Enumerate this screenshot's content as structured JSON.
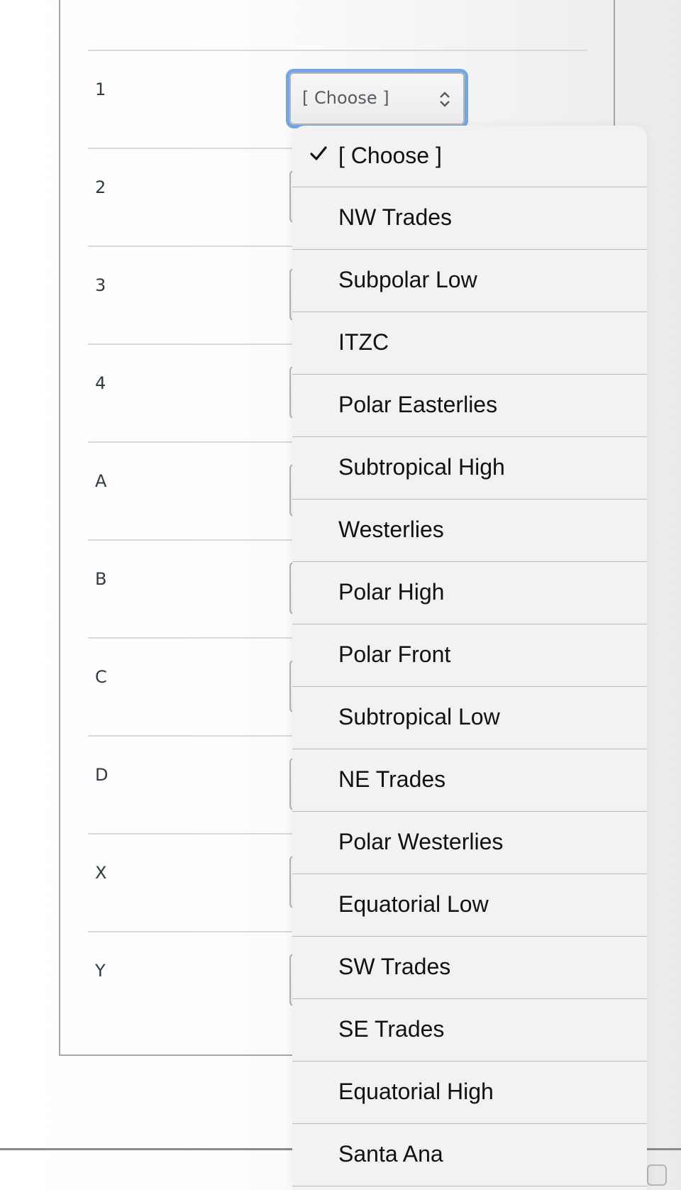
{
  "rows": [
    {
      "label": "1",
      "value": "[ Choose ]",
      "focused": true
    },
    {
      "label": "2",
      "value": ""
    },
    {
      "label": "3",
      "value": ""
    },
    {
      "label": "4",
      "value": ""
    },
    {
      "label": "A",
      "value": ""
    },
    {
      "label": "B",
      "value": ""
    },
    {
      "label": "C",
      "value": ""
    },
    {
      "label": "D",
      "value": ""
    },
    {
      "label": "X",
      "value": ""
    },
    {
      "label": "Y",
      "value": ""
    }
  ],
  "dropdown": {
    "selected_index": 0,
    "options": [
      "[ Choose ]",
      "NW Trades",
      "Subpolar Low",
      "ITZC",
      "Polar Easterlies",
      "Subtropical High",
      "Westerlies",
      "Polar High",
      "Polar Front",
      "Subtropical Low",
      "NE Trades",
      "Polar Westerlies",
      "Equatorial Low",
      "SW Trades",
      "SE Trades",
      "Equatorial High",
      "Santa Ana"
    ]
  },
  "icons": {
    "select_arrows": "chevron-up-down-icon",
    "selected_mark": "checkmark-icon"
  },
  "colors": {
    "focus_ring": "#72a7e6",
    "label_text": "#2d3b45",
    "option_text": "#111111"
  }
}
